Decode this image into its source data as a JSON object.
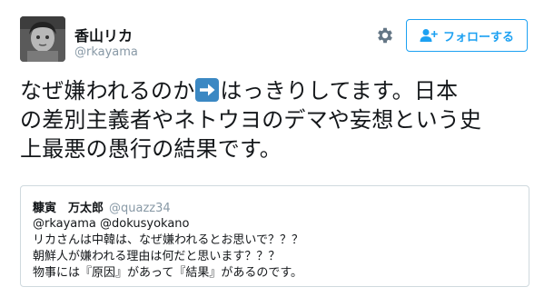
{
  "author": {
    "display_name": "香山リカ",
    "username": "@rkayama",
    "avatar_icon": "profile-photo"
  },
  "actions": {
    "settings_icon": "gear-icon",
    "follow_icon": "follow-person-icon",
    "follow_label": "フォローする"
  },
  "tweet": {
    "line1_before": "なぜ嫌われるのか",
    "emoji_icon": "right-arrow-emoji",
    "line1_after": "はっきりしてます。日本",
    "line2": "の差別主義者やネトウヨのデマや妄想という史",
    "line3": "上最悪の愚行の結果です。"
  },
  "quoted_tweet": {
    "display_name": "糠寅　万太郎",
    "username": "@quazz34",
    "lines": [
      "@rkayama @dokusyokano",
      "リカさんは中韓は、なぜ嫌われるとお思いで？？？",
      "朝鮮人が嫌われる理由は何だと思います？？？",
      "物事には『原因』があって『結果』があるのです。"
    ]
  },
  "colors": {
    "link_blue": "#1da1f2",
    "muted_gray": "#8899a6",
    "text": "#14171a",
    "border": "#cfd9de",
    "emoji_blue": "#3b88c3"
  }
}
